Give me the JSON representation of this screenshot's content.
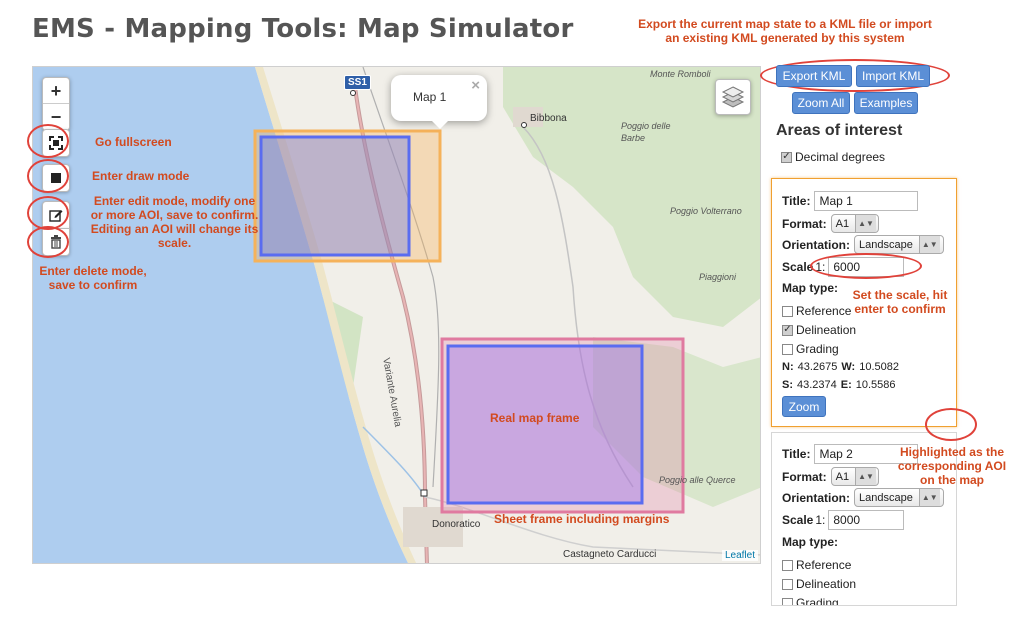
{
  "page_title": "EMS - Mapping Tools: Map Simulator",
  "map": {
    "zoom_in": "+",
    "zoom_out": "−",
    "popup_text": "Map 1",
    "popup_close": "×",
    "road_badge": "SS1",
    "attribution": "Leaflet",
    "aoi_label_map1": "Map 1",
    "place_labels": {
      "monte_romboli": "Monte Romboli",
      "bibbona": "Bibbona",
      "poggio_delle_barbe_1": "Poggio delle",
      "poggio_delle_barbe_2": "Barbe",
      "poggio_volterrano": "Poggio Volterrano",
      "piaggioni": "Piaggioni",
      "poggio_alle_querce": "Poggio alle Querce",
      "donoratico": "Donoratico",
      "castagneto": "Castagneto Carducci",
      "variante_aurelia": "Variante Aurelia"
    },
    "icons": [
      "zoom-in",
      "zoom-out",
      "fullscreen-icon",
      "draw-square-icon",
      "edit-icon",
      "trash-icon",
      "layers-icon"
    ]
  },
  "annotations": {
    "export_note_1": "Export the current map state to a KML file or import",
    "export_note_2": "an existing KML generated by this system",
    "fullscreen": "Go fullscreen",
    "draw": "Enter draw mode",
    "edit_1": "Enter edit mode, modify one",
    "edit_2": "or more AOI, save to confirm.",
    "edit_3": "Editing an AOI will change its",
    "edit_4": "scale.",
    "delete_1": "Enter delete mode,",
    "delete_2": "save to confirm",
    "real_frame": "Real map frame",
    "sheet_frame": "Sheet frame including margins",
    "scale_note_1": "Set the scale, hit",
    "scale_note_2": "enter to confirm",
    "highlight_1": "Highlighted as the",
    "highlight_2": "corresponding AOI",
    "highlight_3": "on the map"
  },
  "toolbar": {
    "export_kml": "Export KML",
    "import_kml": "Import KML",
    "zoom_all": "Zoom All",
    "examples": "Examples"
  },
  "panel": {
    "heading": "Areas of interest",
    "decimal_degrees": "Decimal degrees",
    "decimal_checked": true
  },
  "aois": [
    {
      "title_label": "Title:",
      "title": "Map 1",
      "format_label": "Format:",
      "format": "A1",
      "orientation_label": "Orientation:",
      "orientation": "Landscape",
      "scale_label": "Scale",
      "scale_prefix": "1:",
      "scale": "6000",
      "maptype_label": "Map type:",
      "types": [
        {
          "label": "Reference",
          "checked": false
        },
        {
          "label": "Delineation",
          "checked": true
        },
        {
          "label": "Grading",
          "checked": false
        }
      ],
      "n_label": "N:",
      "n": "43.2675",
      "w_label": "W:",
      "w": "10.5082",
      "s_label": "S:",
      "s": "43.2374",
      "e_label": "E:",
      "e": "10.5586",
      "zoom_label": "Zoom"
    },
    {
      "title_label": "Title:",
      "title": "Map 2",
      "format_label": "Format:",
      "format": "A1",
      "orientation_label": "Orientation:",
      "orientation": "Landscape",
      "scale_label": "Scale",
      "scale_prefix": "1:",
      "scale": "8000",
      "maptype_label": "Map type:",
      "types": [
        {
          "label": "Reference",
          "checked": false
        },
        {
          "label": "Delineation",
          "checked": false
        },
        {
          "label": "Grading",
          "checked": false
        }
      ]
    }
  ],
  "colors": {
    "accent_button": "#5b8fd6",
    "annotation": "#d24a1f",
    "highlight_border": "#f0a030",
    "sea": "#a8c8ec",
    "real_frame": "#5a6cf0",
    "sheet_frame_map1": "#f5b25a",
    "sheet_frame_map2": "#e07aa0"
  }
}
